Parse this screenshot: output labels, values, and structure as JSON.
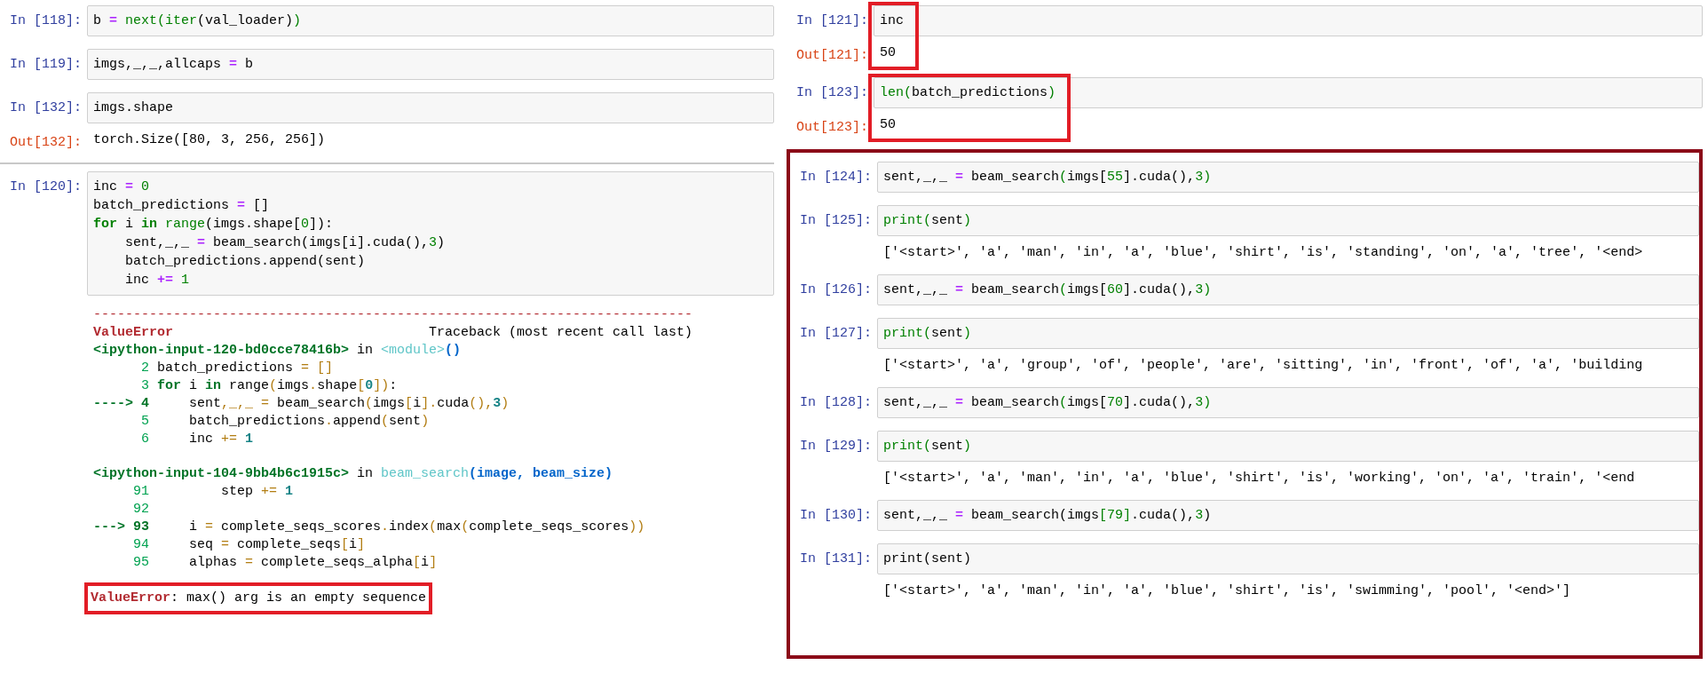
{
  "left": {
    "cells": [
      {
        "prompt": "In [118]:",
        "code": [
          [
            {
              "kind": "plain",
              "text": "b"
            },
            {
              "kind": "op",
              "text": " = "
            },
            {
              "kind": "bi",
              "text": "next(iter"
            },
            {
              "kind": "plain",
              "text": "(val_loader)"
            },
            {
              "kind": "bi",
              "text": ")"
            }
          ]
        ]
      },
      {
        "prompt": "In [119]:",
        "code": [
          [
            {
              "kind": "plain",
              "text": "imgs,_,_,allcaps"
            },
            {
              "kind": "op",
              "text": " = "
            },
            {
              "kind": "plain",
              "text": "b"
            }
          ]
        ]
      },
      {
        "prompt": "In [132]:",
        "code": [
          [
            {
              "kind": "plain",
              "text": "imgs.shape"
            }
          ]
        ],
        "out_prompt": "Out[132]:",
        "output": "torch.Size([80, 3, 256, 256])"
      },
      {
        "prompt": "In [120]:",
        "divider_above": true,
        "code": [
          [
            {
              "kind": "plain",
              "text": "inc"
            },
            {
              "kind": "op",
              "text": " = "
            },
            {
              "kind": "num",
              "text": "0"
            }
          ],
          [
            {
              "kind": "plain",
              "text": "batch_predictions"
            },
            {
              "kind": "op",
              "text": " = "
            },
            {
              "kind": "plain",
              "text": "[]"
            }
          ],
          [
            {
              "kind": "kw",
              "text": "for "
            },
            {
              "kind": "plain",
              "text": "i "
            },
            {
              "kind": "kw",
              "text": "in "
            },
            {
              "kind": "bi",
              "text": "range"
            },
            {
              "kind": "plain",
              "text": "(imgs.shape["
            },
            {
              "kind": "num",
              "text": "0"
            },
            {
              "kind": "plain",
              "text": "]):"
            }
          ],
          [
            {
              "kind": "plain",
              "text": "    sent,_,_"
            },
            {
              "kind": "op",
              "text": " = "
            },
            {
              "kind": "plain",
              "text": "beam_search(imgs[i].cuda(),"
            },
            {
              "kind": "num",
              "text": "3"
            },
            {
              "kind": "plain",
              "text": ")"
            }
          ],
          [
            {
              "kind": "plain",
              "text": "    batch_predictions.append(sent)"
            }
          ],
          [
            {
              "kind": "plain",
              "text": "    inc"
            },
            {
              "kind": "op",
              "text": " += "
            },
            {
              "kind": "num",
              "text": "1"
            }
          ]
        ],
        "traceback": {
          "header": [
            [
              {
                "kind": "dash",
                "text": "---------------------------------------------------------------------------"
              }
            ],
            [
              {
                "kind": "ename",
                "text": "ValueError"
              },
              {
                "kind": "plain",
                "text": "                                Traceback (most recent call last)"
              }
            ]
          ],
          "frames": [
            {
              "lines": [
                [
                  {
                    "kind": "file",
                    "text": "<ipython-input-120-bd0cce78416b>"
                  },
                  {
                    "kind": "plain",
                    "text": " in "
                  },
                  {
                    "kind": "cyan",
                    "text": "<module>"
                  },
                  {
                    "kind": "blue",
                    "text": "()"
                  }
                ],
                [
                  {
                    "kind": "ln",
                    "text": "      2"
                  },
                  {
                    "kind": "plain",
                    "text": " batch_predictions "
                  },
                  {
                    "kind": "brk",
                    "text": "= []"
                  }
                ],
                [
                  {
                    "kind": "ln",
                    "text": "      3"
                  },
                  {
                    "kind": "file",
                    "text": " for "
                  },
                  {
                    "kind": "plain",
                    "text": "i "
                  },
                  {
                    "kind": "file",
                    "text": "in "
                  },
                  {
                    "kind": "plain",
                    "text": "range"
                  },
                  {
                    "kind": "brk",
                    "text": "("
                  },
                  {
                    "kind": "plain",
                    "text": "imgs"
                  },
                  {
                    "kind": "brk",
                    "text": "."
                  },
                  {
                    "kind": "plain",
                    "text": "shape"
                  },
                  {
                    "kind": "brk",
                    "text": "["
                  },
                  {
                    "kind": "tnum",
                    "text": "0"
                  },
                  {
                    "kind": "brk",
                    "text": "])"
                  },
                  {
                    "kind": "plain",
                    "text": ":"
                  }
                ],
                [
                  {
                    "kind": "file",
                    "text": "----> 4"
                  },
                  {
                    "kind": "plain",
                    "text": "     sent"
                  },
                  {
                    "kind": "brk",
                    "text": ",_,_ = "
                  },
                  {
                    "kind": "plain",
                    "text": "beam_search"
                  },
                  {
                    "kind": "brk",
                    "text": "("
                  },
                  {
                    "kind": "plain",
                    "text": "imgs"
                  },
                  {
                    "kind": "brk",
                    "text": "["
                  },
                  {
                    "kind": "plain",
                    "text": "i"
                  },
                  {
                    "kind": "brk",
                    "text": "]."
                  },
                  {
                    "kind": "plain",
                    "text": "cuda"
                  },
                  {
                    "kind": "brk",
                    "text": "(),"
                  },
                  {
                    "kind": "tnum",
                    "text": "3"
                  },
                  {
                    "kind": "brk",
                    "text": ")"
                  }
                ],
                [
                  {
                    "kind": "ln",
                    "text": "      5"
                  },
                  {
                    "kind": "plain",
                    "text": "     batch_predictions"
                  },
                  {
                    "kind": "brk",
                    "text": "."
                  },
                  {
                    "kind": "plain",
                    "text": "append"
                  },
                  {
                    "kind": "brk",
                    "text": "("
                  },
                  {
                    "kind": "plain",
                    "text": "sent"
                  },
                  {
                    "kind": "brk",
                    "text": ")"
                  }
                ],
                [
                  {
                    "kind": "ln",
                    "text": "      6"
                  },
                  {
                    "kind": "plain",
                    "text": "     inc "
                  },
                  {
                    "kind": "brk",
                    "text": "+= "
                  },
                  {
                    "kind": "tnum",
                    "text": "1"
                  }
                ]
              ]
            },
            {
              "lines": [
                [
                  {
                    "kind": "file",
                    "text": "<ipython-input-104-9bb4b6c1915c>"
                  },
                  {
                    "kind": "plain",
                    "text": " in "
                  },
                  {
                    "kind": "cyan",
                    "text": "beam_search"
                  },
                  {
                    "kind": "blue",
                    "text": "(image, beam_size)"
                  }
                ],
                [
                  {
                    "kind": "ln",
                    "text": "     91"
                  },
                  {
                    "kind": "plain",
                    "text": "         step "
                  },
                  {
                    "kind": "brk",
                    "text": "+= "
                  },
                  {
                    "kind": "tnum",
                    "text": "1"
                  }
                ],
                [
                  {
                    "kind": "ln",
                    "text": "     92"
                  }
                ],
                [
                  {
                    "kind": "file",
                    "text": "---> 93"
                  },
                  {
                    "kind": "plain",
                    "text": "     i "
                  },
                  {
                    "kind": "brk",
                    "text": "= "
                  },
                  {
                    "kind": "plain",
                    "text": "complete_seqs_scores"
                  },
                  {
                    "kind": "brk",
                    "text": "."
                  },
                  {
                    "kind": "plain",
                    "text": "index"
                  },
                  {
                    "kind": "brk",
                    "text": "("
                  },
                  {
                    "kind": "plain",
                    "text": "max"
                  },
                  {
                    "kind": "brk",
                    "text": "("
                  },
                  {
                    "kind": "plain",
                    "text": "complete_seqs_scores"
                  },
                  {
                    "kind": "brk",
                    "text": "))"
                  }
                ],
                [
                  {
                    "kind": "ln",
                    "text": "     94"
                  },
                  {
                    "kind": "plain",
                    "text": "     seq "
                  },
                  {
                    "kind": "brk",
                    "text": "= "
                  },
                  {
                    "kind": "plain",
                    "text": "complete_seqs"
                  },
                  {
                    "kind": "brk",
                    "text": "["
                  },
                  {
                    "kind": "plain",
                    "text": "i"
                  },
                  {
                    "kind": "brk",
                    "text": "]"
                  }
                ],
                [
                  {
                    "kind": "ln",
                    "text": "     95"
                  },
                  {
                    "kind": "plain",
                    "text": "     alphas "
                  },
                  {
                    "kind": "brk",
                    "text": "= "
                  },
                  {
                    "kind": "plain",
                    "text": "complete_seqs_alpha"
                  },
                  {
                    "kind": "brk",
                    "text": "["
                  },
                  {
                    "kind": "plain",
                    "text": "i"
                  },
                  {
                    "kind": "brk",
                    "text": "]"
                  }
                ]
              ]
            }
          ],
          "error": [
            {
              "kind": "ename",
              "text": "ValueError"
            },
            {
              "kind": "plain",
              "text": ": max() arg is an empty sequence"
            }
          ],
          "error_highlight": true
        }
      }
    ]
  },
  "right": {
    "cells": [
      {
        "prompt": "In [121]:",
        "code": [
          [
            {
              "kind": "plain",
              "text": "inc"
            }
          ]
        ],
        "out_prompt": "Out[121]:",
        "output": "50",
        "highlight": true
      },
      {
        "prompt": "In [123]:",
        "code": [
          [
            {
              "kind": "bi",
              "text": "len("
            },
            {
              "kind": "plain",
              "text": "batch_predictions"
            },
            {
              "kind": "bi",
              "text": ")"
            }
          ]
        ],
        "out_prompt": "Out[123]:",
        "output": "50",
        "highlight": true
      }
    ],
    "group": {
      "highlight": true,
      "cells": [
        {
          "prompt": "In [124]:",
          "code": [
            [
              {
                "kind": "plain",
                "text": "sent,_,_"
              },
              {
                "kind": "op",
                "text": " = "
              },
              {
                "kind": "plain",
                "text": "beam_search"
              },
              {
                "kind": "bi",
                "text": "("
              },
              {
                "kind": "plain",
                "text": "imgs["
              },
              {
                "kind": "num",
                "text": "55"
              },
              {
                "kind": "plain",
                "text": "].cuda(),"
              },
              {
                "kind": "num",
                "text": "3)"
              }
            ]
          ]
        },
        {
          "prompt": "In [125]:",
          "code": [
            [
              {
                "kind": "bi",
                "text": "print("
              },
              {
                "kind": "plain",
                "text": "sent"
              },
              {
                "kind": "bi",
                "text": ")"
              }
            ]
          ],
          "output": "['<start>', 'a', 'man', 'in', 'a', 'blue', 'shirt', 'is', 'standing', 'on', 'a', 'tree', '<end>"
        },
        {
          "prompt": "In [126]:",
          "code": [
            [
              {
                "kind": "plain",
                "text": "sent,_,_"
              },
              {
                "kind": "op",
                "text": " = "
              },
              {
                "kind": "plain",
                "text": "beam_search"
              },
              {
                "kind": "bi",
                "text": "("
              },
              {
                "kind": "plain",
                "text": "imgs["
              },
              {
                "kind": "num",
                "text": "60"
              },
              {
                "kind": "plain",
                "text": "].cuda(),"
              },
              {
                "kind": "num",
                "text": "3)"
              }
            ]
          ]
        },
        {
          "prompt": "In [127]:",
          "code": [
            [
              {
                "kind": "bi",
                "text": "print("
              },
              {
                "kind": "plain",
                "text": "sent"
              },
              {
                "kind": "bi",
                "text": ")"
              }
            ]
          ],
          "output": "['<start>', 'a', 'group', 'of', 'people', 'are', 'sitting', 'in', 'front', 'of', 'a', 'building"
        },
        {
          "prompt": "In [128]:",
          "code": [
            [
              {
                "kind": "plain",
                "text": "sent,_,_"
              },
              {
                "kind": "op",
                "text": " = "
              },
              {
                "kind": "plain",
                "text": "beam_search"
              },
              {
                "kind": "bi",
                "text": "("
              },
              {
                "kind": "plain",
                "text": "imgs["
              },
              {
                "kind": "num",
                "text": "70"
              },
              {
                "kind": "plain",
                "text": "].cuda(),"
              },
              {
                "kind": "num",
                "text": "3)"
              }
            ]
          ]
        },
        {
          "prompt": "In [129]:",
          "code": [
            [
              {
                "kind": "bi",
                "text": "print("
              },
              {
                "kind": "plain",
                "text": "sent"
              },
              {
                "kind": "bi",
                "text": ")"
              }
            ]
          ],
          "output": "['<start>', 'a', 'man', 'in', 'a', 'blue', 'shirt', 'is', 'working', 'on', 'a', 'train', '<end"
        },
        {
          "prompt": "In [130]:",
          "code": [
            [
              {
                "kind": "plain",
                "text": "sent,_,_"
              },
              {
                "kind": "op",
                "text": " = "
              },
              {
                "kind": "plain",
                "text": "beam_search(imgs"
              },
              {
                "kind": "bi",
                "text": "["
              },
              {
                "kind": "num",
                "text": "79"
              },
              {
                "kind": "bi",
                "text": "]"
              },
              {
                "kind": "plain",
                "text": ".cuda(),"
              },
              {
                "kind": "num",
                "text": "3"
              },
              {
                "kind": "plain",
                "text": ")"
              }
            ]
          ]
        },
        {
          "prompt": "In [131]:",
          "code": [
            [
              {
                "kind": "plain",
                "text": "print(sent)"
              }
            ]
          ],
          "output": "['<start>', 'a', 'man', 'in', 'a', 'blue', 'shirt', 'is', 'swimming', 'pool', '<end>']"
        }
      ]
    }
  }
}
